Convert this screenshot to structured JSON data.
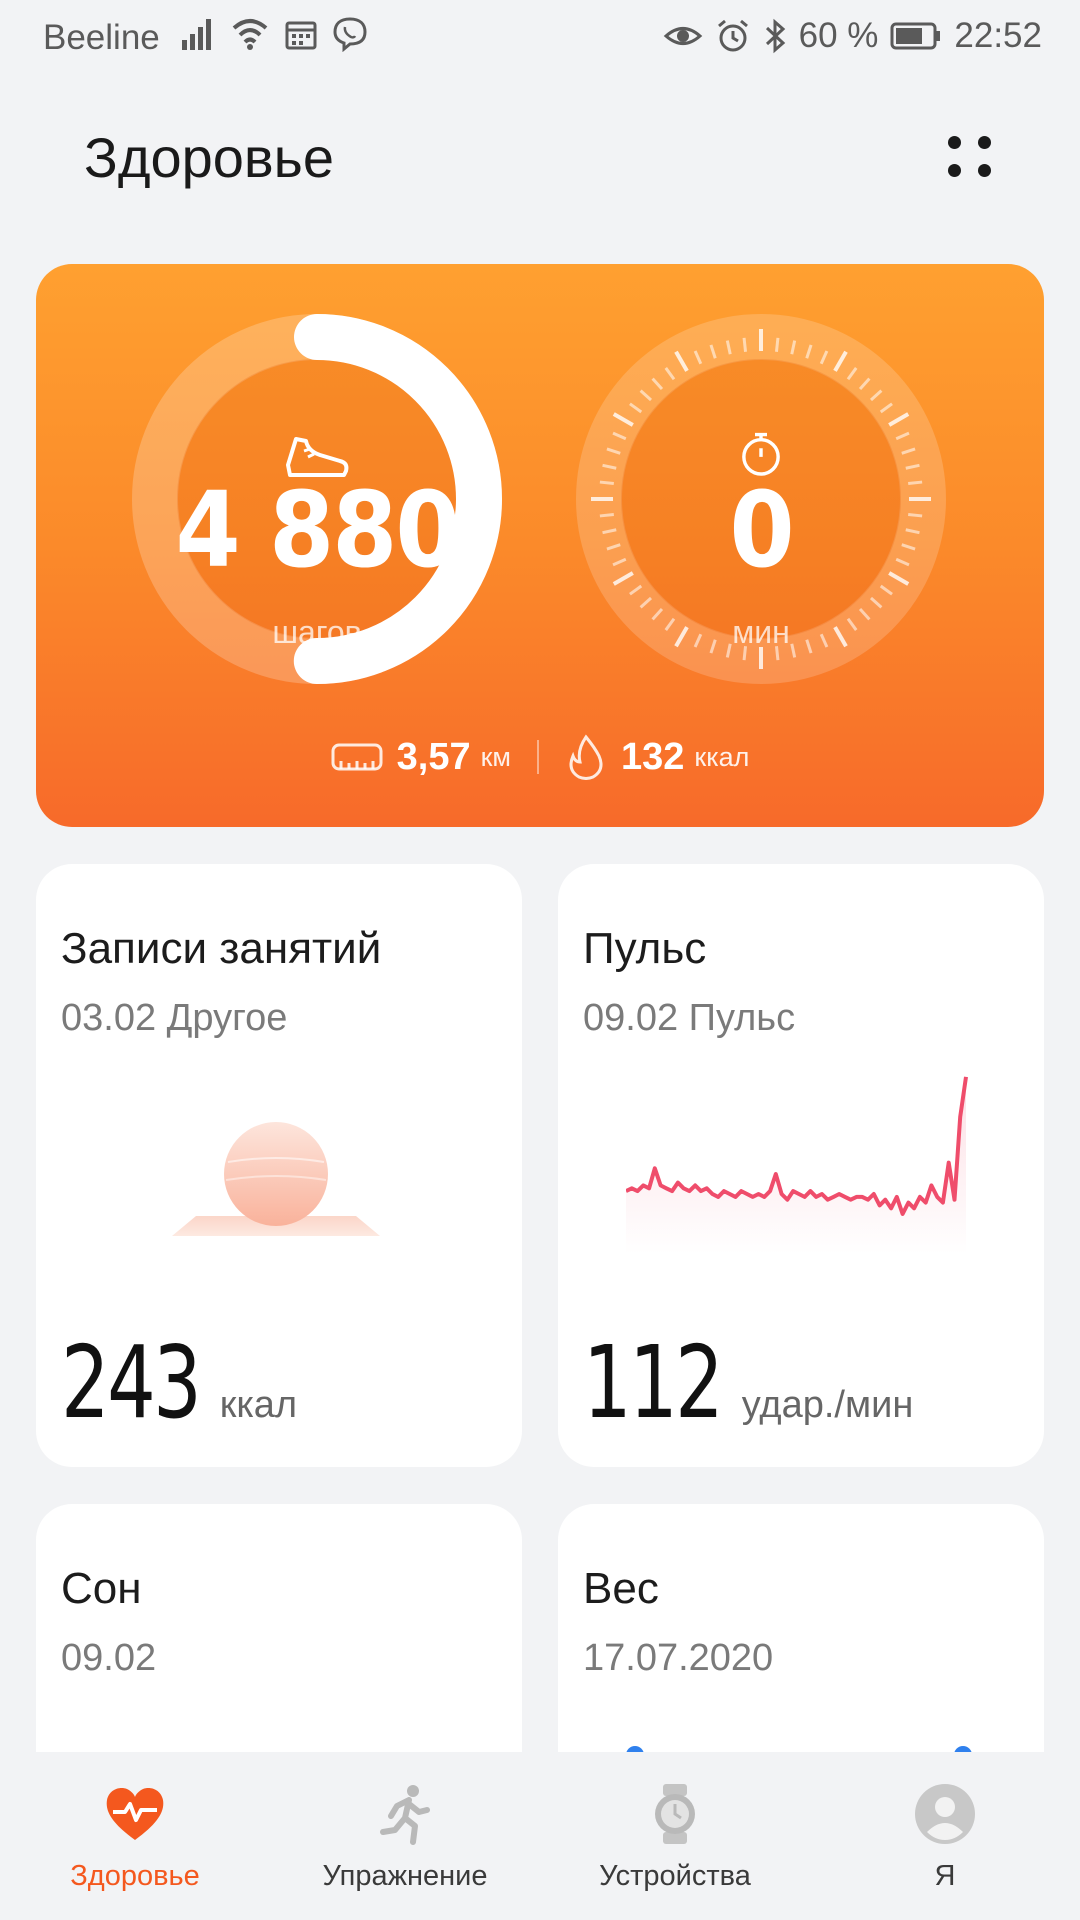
{
  "status_bar": {
    "carrier": "Beeline",
    "battery": "60 %",
    "time": "22:52"
  },
  "header": {
    "title": "Здоровье"
  },
  "activity": {
    "steps_value": "4 880",
    "steps_unit": "шагов",
    "steps_ring_progress": 0.5,
    "minutes_value": "0",
    "minutes_unit": "мин",
    "distance_value": "3,57",
    "distance_unit": "км",
    "calories_value": "132",
    "calories_unit": "ккал"
  },
  "cards": {
    "workouts": {
      "title": "Записи занятий",
      "subtitle": "03.02 Другое",
      "value": "243",
      "unit": "ккал"
    },
    "pulse": {
      "title": "Пульс",
      "subtitle": "09.02 Пульс",
      "value": "112",
      "unit": "удар./мин"
    },
    "sleep": {
      "title": "Сон",
      "subtitle": "09.02"
    },
    "weight": {
      "title": "Вес",
      "subtitle": "17.07.2020"
    }
  },
  "nav": {
    "items": [
      {
        "label": "Здоровье",
        "icon": "heart-pulse-icon",
        "active": true
      },
      {
        "label": "Упражнение",
        "icon": "running-man-icon",
        "active": false
      },
      {
        "label": "Устройства",
        "icon": "watch-icon",
        "active": false
      },
      {
        "label": "Я",
        "icon": "avatar-icon",
        "active": false
      }
    ]
  },
  "colors": {
    "accent": "#f4581e",
    "hero_top": "#ffa030",
    "hero_bottom": "#f76a2a",
    "pulse_line": "#ef4d6b"
  },
  "chart_data": {
    "type": "line",
    "x": [
      1,
      2,
      3,
      4,
      5,
      6,
      7,
      8,
      9,
      10,
      11,
      12,
      13,
      14,
      15,
      16,
      17,
      18,
      19,
      20,
      21,
      22,
      23,
      24,
      25,
      26,
      27,
      28,
      29,
      30,
      31,
      32,
      33,
      34,
      35,
      36,
      37,
      38,
      39,
      40,
      41,
      42,
      43,
      44,
      45,
      46,
      47,
      48,
      49,
      50,
      51,
      52,
      53,
      54,
      55,
      56,
      57,
      58,
      59,
      60
    ],
    "values": [
      62,
      63,
      62,
      64,
      63,
      70,
      64,
      63,
      62,
      65,
      63,
      62,
      64,
      62,
      63,
      61,
      60,
      62,
      61,
      60,
      62,
      61,
      60,
      61,
      60,
      62,
      68,
      61,
      59,
      62,
      61,
      60,
      62,
      60,
      61,
      59,
      60,
      61,
      60,
      59,
      60,
      60,
      59,
      61,
      57,
      59,
      56,
      60,
      54,
      58,
      56,
      60,
      58,
      64,
      60,
      58,
      72,
      59,
      88,
      102
    ],
    "title": "",
    "xlabel": "",
    "ylabel": "",
    "ylim": [
      40,
      110
    ]
  }
}
